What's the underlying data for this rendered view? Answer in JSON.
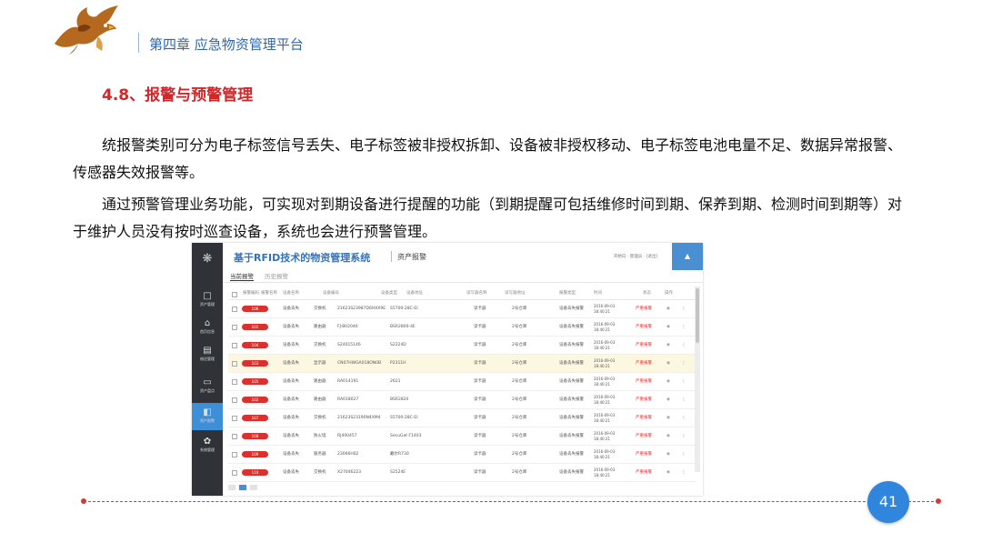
{
  "header": {
    "chapter": "第四章  应急物资管理平台"
  },
  "section": {
    "title": "4.8、报警与预警管理"
  },
  "body": {
    "para1": "统报警类别可分为电子标签信号丢失、电子标签被非授权拆卸、设备被非授权移动、电子标签电池电量不足、数据异常报警、传感器失效报警等。",
    "para2": "通过预警管理业务功能，可实现对到期设备进行提醒的功能（到期提醒可包括维修时间到期、保养到期、检测时间到期等）对于维护人员没有按时巡查设备，系统也会进行预警管理。"
  },
  "screenshot": {
    "system_title": "基于RFID技术的物资管理系统",
    "page_title": "资产报警",
    "user_info": "开始向 · 管理员 · [退出]",
    "top_button_icon": "bell-icon",
    "tabs": [
      "当前报警",
      "历史报警"
    ],
    "sidebar": [
      {
        "label": "资产管理",
        "icon": "□"
      },
      {
        "label": "首页信息",
        "icon": "⌂"
      },
      {
        "label": "借还管理",
        "icon": "▤"
      },
      {
        "label": "资产盘点",
        "icon": "▭"
      },
      {
        "label": "资产报警",
        "icon": "◧"
      },
      {
        "label": "系统管理",
        "icon": "✿"
      }
    ],
    "columns": [
      "报警编码",
      "报警名称",
      "设备名称",
      "设备编号",
      "设备类型",
      "设备地址",
      "读写器名称",
      "读写器地址",
      "报警类型",
      "时间",
      "状态",
      "操作"
    ],
    "rows": [
      {
        "alarm": "106",
        "name": "设备丢失",
        "device": "交换机",
        "code": "21623S23987D6HXX9E",
        "type": "S5700-28C-EI",
        "addr": "",
        "reader": "读卡器",
        "readerAddr": "2号仓库",
        "alarmType": "设备丢失报警",
        "date": "2016-09-03",
        "time": "18:40:21",
        "status": "严重报警"
      },
      {
        "alarm": "101",
        "name": "设备丢失",
        "device": "路由器",
        "code": "FJ-B02046",
        "type": "BSR2800-4E",
        "addr": "",
        "reader": "读卡器",
        "readerAddr": "2号仓库",
        "alarmType": "设备丢失报警",
        "date": "2016-09-03",
        "time": "18:40:21",
        "status": "严重报警"
      },
      {
        "alarm": "104",
        "name": "设备丢失",
        "device": "交换机",
        "code": "S24015146",
        "type": "S2224D",
        "addr": "",
        "reader": "读卡器",
        "readerAddr": "2号仓库",
        "alarmType": "设备丢失报警",
        "date": "2016-09-03",
        "time": "18:40:21",
        "status": "严重报警"
      },
      {
        "alarm": "103",
        "name": "设备丢失",
        "device": "显示器",
        "code": "CN07HWGA018ON0B",
        "type": "P2311H",
        "addr": "",
        "reader": "读卡器",
        "readerAddr": "2号仓库",
        "alarmType": "设备丢失报警",
        "date": "2016-09-03",
        "time": "18:40:21",
        "status": "严重报警"
      },
      {
        "alarm": "105",
        "name": "设备丢失",
        "device": "路由器",
        "code": "RA014191",
        "type": "2621",
        "addr": "",
        "reader": "读卡器",
        "readerAddr": "2号仓库",
        "alarmType": "设备丢失报警",
        "date": "2016-09-03",
        "time": "18:40:21",
        "status": "严重报警"
      },
      {
        "alarm": "102",
        "name": "设备丢失",
        "device": "路由器",
        "code": "RA018027",
        "type": "BSR2820",
        "addr": "",
        "reader": "读卡器",
        "readerAddr": "2号仓库",
        "alarmType": "设备丢失报警",
        "date": "2016-09-03",
        "time": "18:40:21",
        "status": "严重报警"
      },
      {
        "alarm": "107",
        "name": "设备丢失",
        "device": "交换机",
        "code": "21623S23190N4XM4",
        "type": "S5700-28C-EI",
        "addr": "",
        "reader": "读卡器",
        "readerAddr": "2号仓库",
        "alarmType": "设备丢失报警",
        "date": "2016-09-03",
        "time": "18:40:21",
        "status": "严重报警"
      },
      {
        "alarm": "108",
        "name": "设备丢失",
        "device": "防火墙",
        "code": "RJ400457",
        "type": "SecuGat F1403",
        "addr": "",
        "reader": "读卡器",
        "readerAddr": "2号仓库",
        "alarmType": "设备丢失报警",
        "date": "2016-09-03",
        "time": "18:40:21",
        "status": "严重报警"
      },
      {
        "alarm": "109",
        "name": "设备丢失",
        "device": "服务器",
        "code": "23066H02",
        "type": "戴尔R730",
        "addr": "",
        "reader": "读卡器",
        "readerAddr": "2号仓库",
        "alarmType": "设备丢失报警",
        "date": "2016-09-03",
        "time": "18:40:21",
        "status": "严重报警"
      },
      {
        "alarm": "110",
        "name": "设备丢失",
        "device": "交换机",
        "code": "X27046223",
        "type": "S2524E",
        "addr": "",
        "reader": "读卡器",
        "readerAddr": "2号仓库",
        "alarmType": "设备丢失报警",
        "date": "2016-09-03",
        "time": "18:40:21",
        "status": "严重报警"
      }
    ]
  },
  "footer": {
    "page_number": "41"
  },
  "colors": {
    "accent_red": "#d0272a",
    "accent_blue": "#2f86dc",
    "chapter_blue": "#2e67b1"
  }
}
